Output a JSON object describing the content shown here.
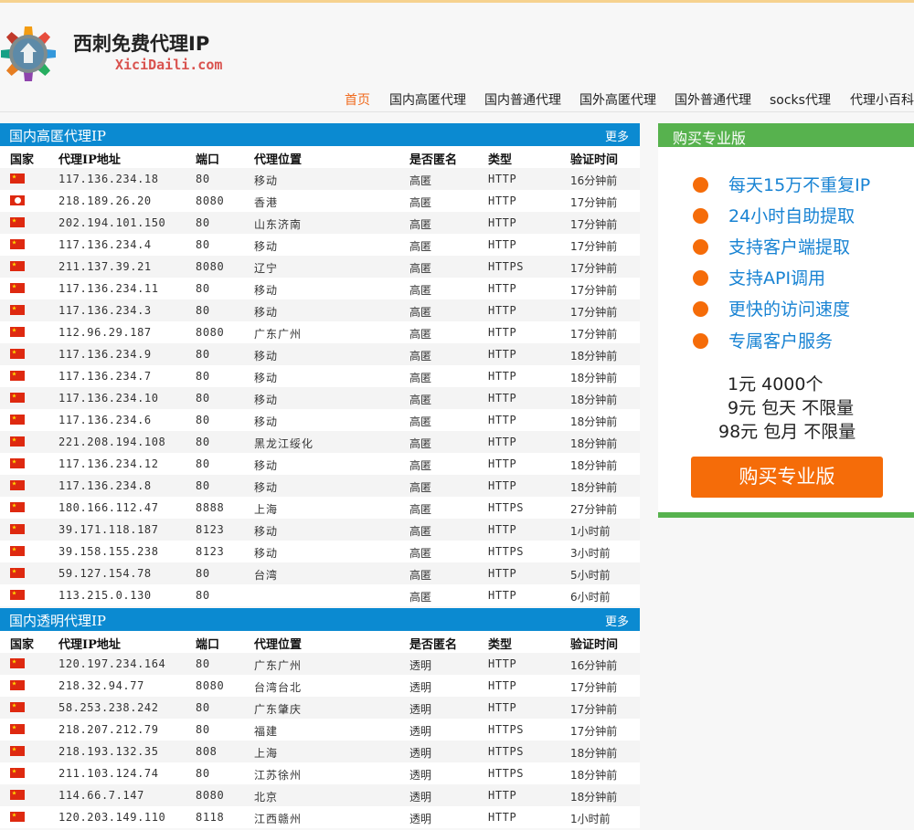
{
  "site": {
    "title": "西刺免费代理IP",
    "domain": "XiciDaili.com"
  },
  "nav": [
    {
      "label": "首页",
      "active": true
    },
    {
      "label": "国内高匿代理"
    },
    {
      "label": "国内普通代理"
    },
    {
      "label": "国外高匿代理"
    },
    {
      "label": "国外普通代理"
    },
    {
      "label": "socks代理"
    },
    {
      "label": "代理小百科"
    }
  ],
  "columns": [
    "国家",
    "代理IP地址",
    "端口",
    "代理位置",
    "是否匿名",
    "类型",
    "验证时间"
  ],
  "sections": [
    {
      "title": "国内高匿代理IP",
      "more": "更多",
      "rows": [
        {
          "flag": "cn",
          "ip": "117.136.234.18",
          "port": "80",
          "location": "移动",
          "anon": "高匿",
          "type": "HTTP",
          "time": "16分钟前"
        },
        {
          "flag": "hk",
          "ip": "218.189.26.20",
          "port": "8080",
          "location": "香港",
          "anon": "高匿",
          "type": "HTTP",
          "time": "17分钟前"
        },
        {
          "flag": "cn",
          "ip": "202.194.101.150",
          "port": "80",
          "location": "山东济南",
          "anon": "高匿",
          "type": "HTTP",
          "time": "17分钟前"
        },
        {
          "flag": "cn",
          "ip": "117.136.234.4",
          "port": "80",
          "location": "移动",
          "anon": "高匿",
          "type": "HTTP",
          "time": "17分钟前"
        },
        {
          "flag": "cn",
          "ip": "211.137.39.21",
          "port": "8080",
          "location": "辽宁",
          "anon": "高匿",
          "type": "HTTPS",
          "time": "17分钟前"
        },
        {
          "flag": "cn",
          "ip": "117.136.234.11",
          "port": "80",
          "location": "移动",
          "anon": "高匿",
          "type": "HTTP",
          "time": "17分钟前"
        },
        {
          "flag": "cn",
          "ip": "117.136.234.3",
          "port": "80",
          "location": "移动",
          "anon": "高匿",
          "type": "HTTP",
          "time": "17分钟前"
        },
        {
          "flag": "cn",
          "ip": "112.96.29.187",
          "port": "8080",
          "location": "广东广州",
          "anon": "高匿",
          "type": "HTTP",
          "time": "17分钟前"
        },
        {
          "flag": "cn",
          "ip": "117.136.234.9",
          "port": "80",
          "location": "移动",
          "anon": "高匿",
          "type": "HTTP",
          "time": "18分钟前"
        },
        {
          "flag": "cn",
          "ip": "117.136.234.7",
          "port": "80",
          "location": "移动",
          "anon": "高匿",
          "type": "HTTP",
          "time": "18分钟前"
        },
        {
          "flag": "cn",
          "ip": "117.136.234.10",
          "port": "80",
          "location": "移动",
          "anon": "高匿",
          "type": "HTTP",
          "time": "18分钟前"
        },
        {
          "flag": "cn",
          "ip": "117.136.234.6",
          "port": "80",
          "location": "移动",
          "anon": "高匿",
          "type": "HTTP",
          "time": "18分钟前"
        },
        {
          "flag": "cn",
          "ip": "221.208.194.108",
          "port": "80",
          "location": "黑龙江绥化",
          "anon": "高匿",
          "type": "HTTP",
          "time": "18分钟前"
        },
        {
          "flag": "cn",
          "ip": "117.136.234.12",
          "port": "80",
          "location": "移动",
          "anon": "高匿",
          "type": "HTTP",
          "time": "18分钟前"
        },
        {
          "flag": "cn",
          "ip": "117.136.234.8",
          "port": "80",
          "location": "移动",
          "anon": "高匿",
          "type": "HTTP",
          "time": "18分钟前"
        },
        {
          "flag": "cn",
          "ip": "180.166.112.47",
          "port": "8888",
          "location": "上海",
          "anon": "高匿",
          "type": "HTTPS",
          "time": "27分钟前"
        },
        {
          "flag": "cn",
          "ip": "39.171.118.187",
          "port": "8123",
          "location": "移动",
          "anon": "高匿",
          "type": "HTTP",
          "time": "1小时前"
        },
        {
          "flag": "cn",
          "ip": "39.158.155.238",
          "port": "8123",
          "location": "移动",
          "anon": "高匿",
          "type": "HTTPS",
          "time": "3小时前"
        },
        {
          "flag": "cn",
          "ip": "59.127.154.78",
          "port": "80",
          "location": "台湾",
          "anon": "高匿",
          "type": "HTTP",
          "time": "5小时前"
        },
        {
          "flag": "cn",
          "ip": "113.215.0.130",
          "port": "80",
          "location": "",
          "anon": "高匿",
          "type": "HTTP",
          "time": "6小时前"
        }
      ]
    },
    {
      "title": "国内透明代理IP",
      "more": "更多",
      "rows": [
        {
          "flag": "cn",
          "ip": "120.197.234.164",
          "port": "80",
          "location": "广东广州",
          "anon": "透明",
          "type": "HTTP",
          "time": "16分钟前"
        },
        {
          "flag": "cn",
          "ip": "218.32.94.77",
          "port": "8080",
          "location": "台湾台北",
          "anon": "透明",
          "type": "HTTP",
          "time": "17分钟前"
        },
        {
          "flag": "cn",
          "ip": "58.253.238.242",
          "port": "80",
          "location": "广东肇庆",
          "anon": "透明",
          "type": "HTTP",
          "time": "17分钟前"
        },
        {
          "flag": "cn",
          "ip": "218.207.212.79",
          "port": "80",
          "location": "福建",
          "anon": "透明",
          "type": "HTTPS",
          "time": "17分钟前"
        },
        {
          "flag": "cn",
          "ip": "218.193.132.35",
          "port": "808",
          "location": "上海",
          "anon": "透明",
          "type": "HTTPS",
          "time": "18分钟前"
        },
        {
          "flag": "cn",
          "ip": "211.103.124.74",
          "port": "80",
          "location": "江苏徐州",
          "anon": "透明",
          "type": "HTTPS",
          "time": "18分钟前"
        },
        {
          "flag": "cn",
          "ip": "114.66.7.147",
          "port": "8080",
          "location": "北京",
          "anon": "透明",
          "type": "HTTP",
          "time": "18分钟前"
        },
        {
          "flag": "cn",
          "ip": "120.203.149.110",
          "port": "8118",
          "location": "江西赣州",
          "anon": "透明",
          "type": "HTTP",
          "time": "1小时前"
        }
      ]
    }
  ],
  "sidebar": {
    "title": "购买专业版",
    "features": [
      "每天15万不重复IP",
      "24小时自助提取",
      "支持客户端提取",
      "支持API调用",
      "更快的访问速度",
      "专属客户服务"
    ],
    "prices": [
      "1元 4000个",
      "9元 包天 不限量",
      "98元 包月 不限量"
    ],
    "button": "购买专业版"
  },
  "colors": {
    "table_header_blue": "#0b8ad1",
    "sidebar_green": "#57b24e",
    "accent_orange": "#f56c09",
    "feature_blue": "#1883d3",
    "nav_active": "#f06a1d"
  }
}
